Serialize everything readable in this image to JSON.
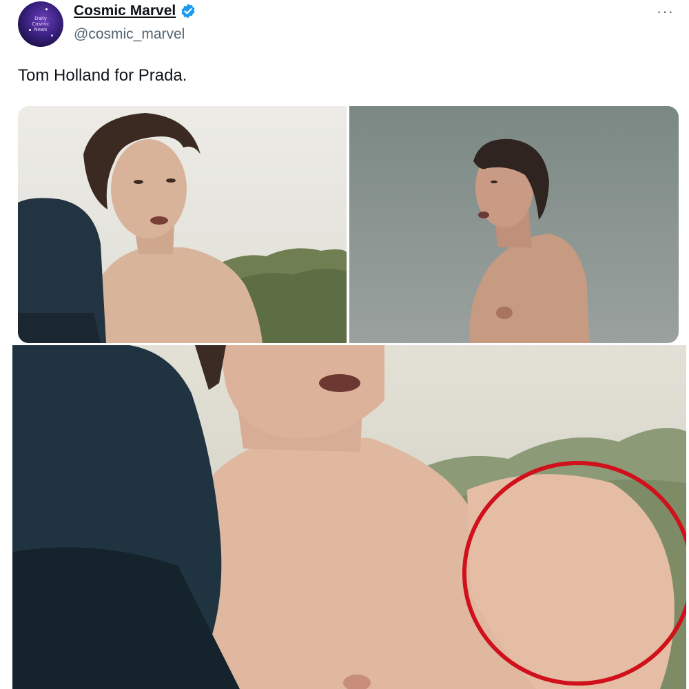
{
  "author": {
    "display_name": "Cosmic Marvel",
    "handle": "@cosmic_marvel",
    "avatar_text": "Daily\nCosmic\nNews",
    "verified_color": "#1d9bf0"
  },
  "menu": {
    "more_label": "···"
  },
  "tweet": {
    "text": "Tom Holland for Prada."
  },
  "media": {
    "photos": [
      "photo-1",
      "photo-2",
      "photo-3"
    ],
    "highlight_color": "#d0101a"
  },
  "icons": {
    "verified": "verified-badge-icon",
    "more": "more-options-icon"
  }
}
